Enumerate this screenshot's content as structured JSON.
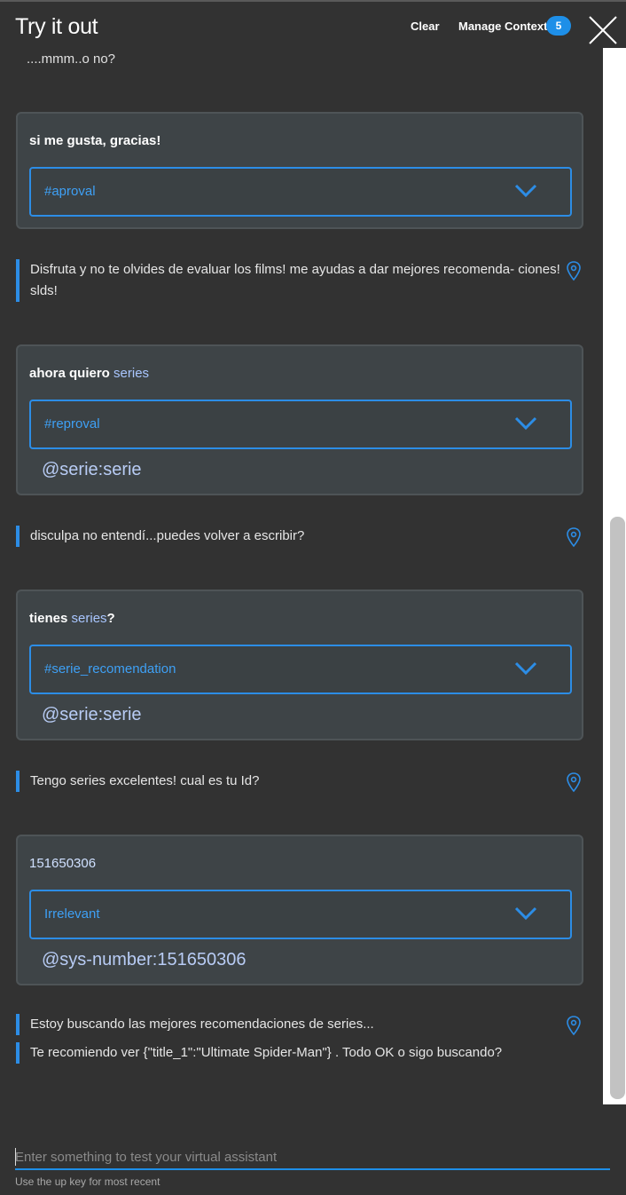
{
  "header": {
    "title": "Try it out",
    "clear_label": "Clear",
    "manage_context_label": "Manage Context",
    "context_count": "5"
  },
  "conversation": {
    "cut_text": "....mmm..o no?",
    "turns": [
      {
        "user_text": "si me gusta, gracias!",
        "intent": "#aproval",
        "entity": "",
        "reply": "Disfruta y no te olvides de evaluar los films! me ayudas a dar mejores recomenda- ciones! slds!"
      },
      {
        "user_text_prefix": "ahora quiero ",
        "user_text_entity": "series",
        "intent": "#reproval",
        "entity": "@serie:serie",
        "reply": "disculpa no entendí...puedes volver a escribir?"
      },
      {
        "user_text_prefix": "tienes ",
        "user_text_entity": "series",
        "user_text_suffix": "?",
        "intent": "#serie_recomendation",
        "entity": "@serie:serie",
        "reply": "Tengo series excelentes! cual es tu Id?"
      },
      {
        "user_text": "151650306",
        "intent": "Irrelevant",
        "entity": "@sys-number:151650306",
        "reply": "Estoy buscando las mejores recomendaciones de series...",
        "reply_2": "Te recomiendo ver {\"title_1\":\"Ultimate Spider-Man\"} . Todo OK o sigo buscando?"
      }
    ]
  },
  "input": {
    "placeholder": "Enter something to test your virtual assistant",
    "hint": "Use the up key for most recent"
  },
  "colors": {
    "accent": "#1e8fe8",
    "intent_text": "#3ea0f5",
    "entity_text": "#b8ccf5",
    "background": "#323232",
    "card": "#3e4447"
  },
  "icons": [
    "close-icon",
    "chevron-down-icon",
    "location-pin-icon"
  ]
}
